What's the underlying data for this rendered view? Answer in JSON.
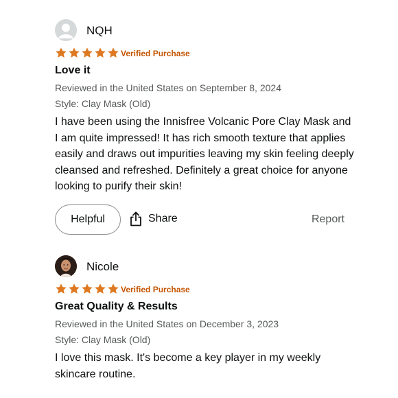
{
  "colors": {
    "star": "#de7921",
    "verified": "#c45500",
    "meta": "#565959",
    "text": "#0f1111"
  },
  "reviews": [
    {
      "reviewer": "NQH",
      "avatar": "default-avatar-icon",
      "rating": 5,
      "verified": "Verified Purchase",
      "title": "Love it",
      "meta": "Reviewed in the United States on September 8, 2024",
      "style": "Style: Clay Mask (Old)",
      "body": "I have been using the Innisfree Volcanic Pore Clay Mask and I am quite impressed! It has rich smooth texture that applies easily and draws out impurities leaving my skin feeling deeply cleansed and refreshed. Definitely a great choice for anyone looking to purify their skin!",
      "actions": {
        "helpful": "Helpful",
        "share": "Share",
        "report": "Report"
      }
    },
    {
      "reviewer": "Nicole",
      "avatar": "user-photo",
      "rating": 5,
      "verified": "Verified Purchase",
      "title": "Great Quality & Results",
      "meta": "Reviewed in the United States on December 3, 2023",
      "style": "Style: Clay Mask (Old)",
      "body": "I love this mask. It's become a key player in my weekly skincare routine."
    }
  ]
}
